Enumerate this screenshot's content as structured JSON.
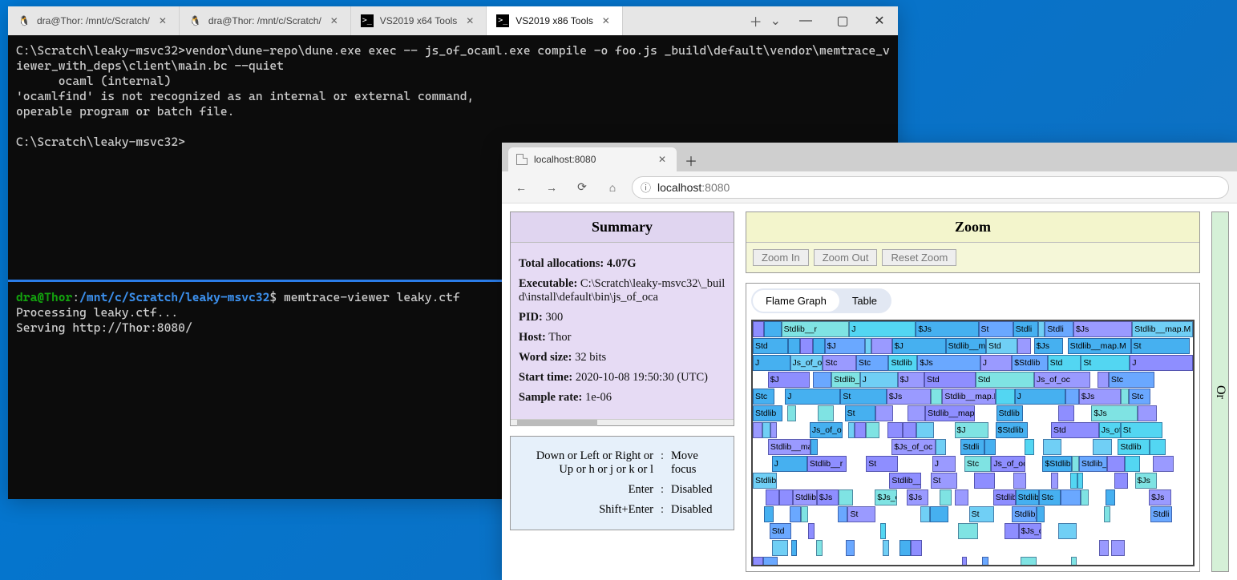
{
  "terminal": {
    "tabs": [
      {
        "label": "dra@Thor: /mnt/c/Scratch/",
        "kind": "linux",
        "active": false
      },
      {
        "label": "dra@Thor: /mnt/c/Scratch/",
        "kind": "linux",
        "active": false
      },
      {
        "label": "VS2019 x64 Tools",
        "kind": "cmd",
        "active": false
      },
      {
        "label": "VS2019 x86 Tools",
        "kind": "cmd",
        "active": true
      }
    ],
    "top_prompt": "C:\\Scratch\\leaky-msvc32>",
    "top_cmd": "vendor\\dune-repo\\dune.exe exec -- js_of_ocaml.exe compile -o foo.js _build\\default\\vendor\\memtrace_viewer_with_deps\\client\\main.bc --quiet",
    "top_out1": "      ocaml (internal)",
    "top_out2": "'ocamlfind' is not recognized as an internal or external command,",
    "top_out3": "operable program or batch file.",
    "top_prompt2": "C:\\Scratch\\leaky-msvc32>",
    "bottom": {
      "user": "dra@Thor",
      "colon": ":",
      "path": "/mnt/c/Scratch/leaky-msvc32",
      "dollar": "$ ",
      "cmd": "memtrace-viewer leaky.ctf",
      "out1": "Processing leaky.ctf...",
      "out2": "Serving http://Thor:8080/"
    }
  },
  "browser": {
    "tab_label": "localhost:8080",
    "url_host": "localhost",
    "url_port": ":8080",
    "summary": {
      "title": "Summary",
      "total_alloc_k": "Total allocations:",
      "total_alloc_v": "4.07G",
      "exe_k": "Executable:",
      "exe_v": "C:\\Scratch\\leaky-msvc32\\_build\\install\\default\\bin\\js_of_oca",
      "pid_k": "PID:",
      "pid_v": "300",
      "host_k": "Host:",
      "host_v": "Thor",
      "word_k": "Word size:",
      "word_v": "32 bits",
      "start_k": "Start time:",
      "start_v": "2020-10-08 19:50:30 (UTC)",
      "rate_k": "Sample rate:",
      "rate_v": "1e-06"
    },
    "help": [
      {
        "k": "Down or Left or Right or Up or h or j or k or l",
        "v": "Move focus"
      },
      {
        "k": "Enter",
        "v": "Disabled"
      },
      {
        "k": "Shift+Enter",
        "v": "Disabled"
      }
    ],
    "zoom": {
      "title": "Zoom",
      "btn_in": "Zoom In",
      "btn_out": "Zoom Out",
      "btn_reset": "Reset Zoom"
    },
    "flame": {
      "tab_flame": "Flame Graph",
      "tab_table": "Table"
    },
    "right_label": "Or"
  }
}
